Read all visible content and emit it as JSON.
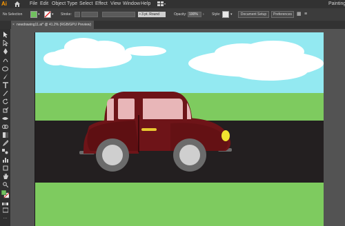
{
  "app": {
    "logo": "Ai",
    "workspace": "Painting"
  },
  "menu": {
    "items": [
      "File",
      "Edit",
      "Object",
      "Type",
      "Select",
      "Effect",
      "View",
      "Window",
      "Help"
    ]
  },
  "control": {
    "selection": "No Selection",
    "stroke_label": "Stroke:",
    "brush": "3 pt. Round",
    "opacity_label": "Opacity:",
    "opacity_value": "100%",
    "style_label": "Style:",
    "document_setup": "Document Setup",
    "preferences": "Preferences",
    "fill_color": "#70c05e"
  },
  "document_tab": {
    "title": "newdrawing11.ai* @ 41.2% (RGB/GPU Preview)"
  },
  "icons": {
    "home": "home-icon",
    "layout": "arrange-documents-icon",
    "tools": [
      "selection-tool-icon",
      "direct-selection-tool-icon",
      "pen-tool-icon",
      "curvature-tool-icon",
      "ellipse-tool-icon",
      "paintbrush-tool-icon",
      "pencil-tool-icon",
      "type-tool-icon",
      "line-tool-icon",
      "rotate-tool-icon",
      "scale-tool-icon",
      "width-tool-icon",
      "shape-builder-tool-icon",
      "gradient-tool-icon",
      "eyedropper-tool-icon",
      "blend-tool-icon",
      "symbol-sprayer-tool-icon",
      "graph-tool-icon",
      "artboard-tool-icon",
      "hand-tool-icon",
      "zoom-tool-icon",
      "fill-swatch",
      "stroke-swatch",
      "swap-fill-stroke-icon",
      "color-mode-icon",
      "screen-mode-icon",
      "more-tools-icon"
    ]
  },
  "scene_colors": {
    "sky": "#93e9f1",
    "cloud": "#ffffff",
    "grass": "#7ecb5f",
    "road": "#231f20",
    "car_body": "#6e1418",
    "car_body_dark": "#5a0f12",
    "window": "#e8b6b8",
    "wheel_outer": "#6b6b6b",
    "wheel_inner": "#cfcfcf",
    "headlight": "#f2e230",
    "handle": "#e8c830"
  }
}
